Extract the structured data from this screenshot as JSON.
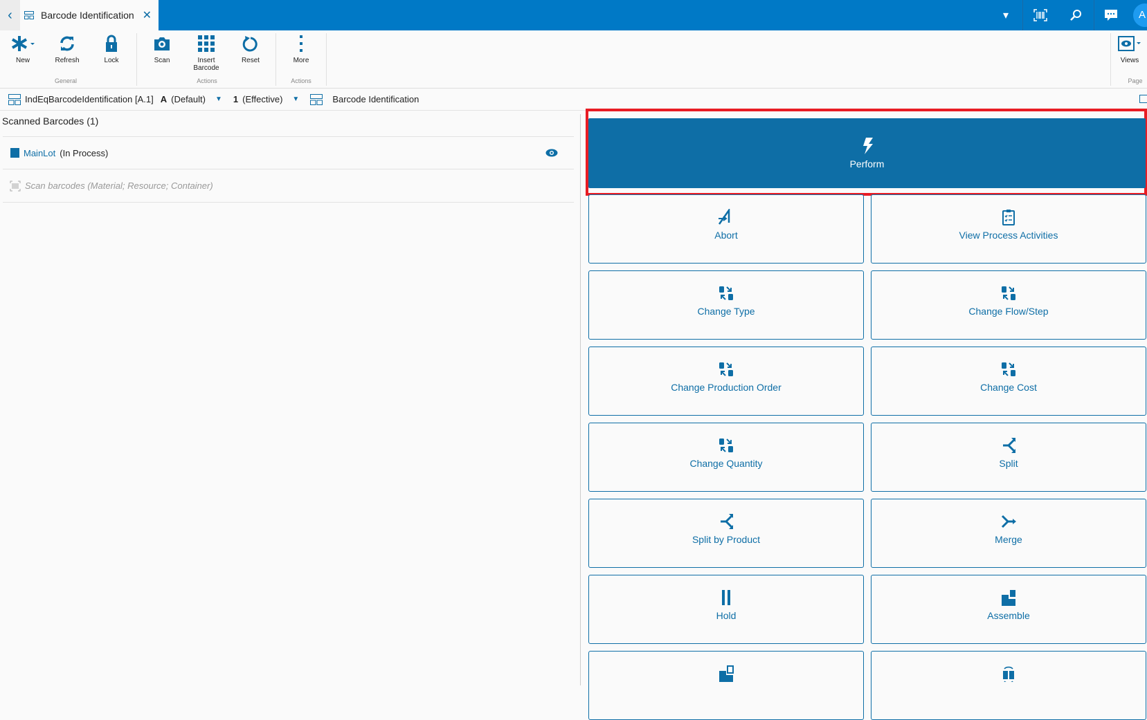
{
  "tab": {
    "title": "Barcode Identification"
  },
  "ribbon": {
    "buttons": {
      "new": "New",
      "refresh": "Refresh",
      "lock": "Lock",
      "scan": "Scan",
      "insert_barcode_1": "Insert",
      "insert_barcode_2": "Barcode",
      "reset": "Reset",
      "more": "More",
      "views": "Views"
    },
    "groups": {
      "general": "General",
      "actions1": "Actions",
      "actions2": "Actions",
      "page": "Page"
    }
  },
  "breadcrumb": {
    "page": "IndEqBarcodeIdentification [A.1]",
    "revision_letter": "A",
    "revision_label": "(Default)",
    "version_num": "1",
    "version_label": "(Effective)",
    "title": "Barcode Identification"
  },
  "left": {
    "header": "Scanned Barcodes (1)",
    "item_name": "MainLot",
    "item_status": "(In Process)",
    "scan_placeholder": "Scan barcodes (Material; Resource; Container)"
  },
  "actions": {
    "perform": "Perform",
    "items": [
      "Abort",
      "View Process Activities",
      "Change Type",
      "Change Flow/Step",
      "Change Production Order",
      "Change Cost",
      "Change Quantity",
      "Split",
      "Split by Product",
      "Merge",
      "Hold",
      "Assemble",
      "",
      ""
    ]
  },
  "user": {
    "initial": "A"
  },
  "colors": {
    "accent": "#0e6ea6",
    "topbar": "#0079c6",
    "highlight": "#e81c24"
  }
}
